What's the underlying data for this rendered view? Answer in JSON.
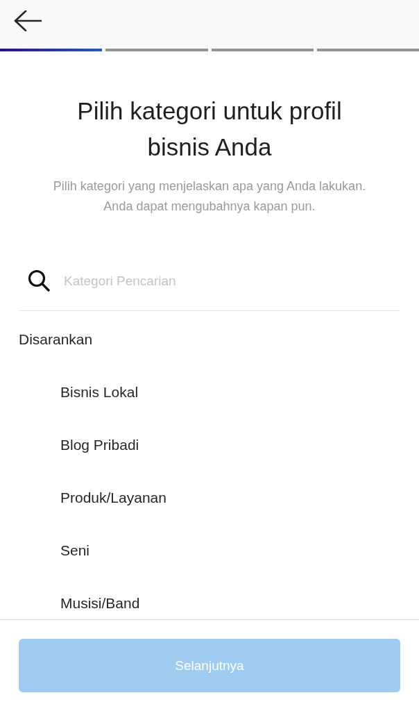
{
  "progress": {
    "steps": [
      {
        "completed": true
      },
      {
        "completed": false
      },
      {
        "completed": false
      },
      {
        "completed": false
      }
    ]
  },
  "title": "Pilih kategori untuk profil bisnis Anda",
  "subtitle": "Pilih kategori yang menjelaskan apa yang Anda lakukan. Anda dapat mengubahnya kapan pun.",
  "search": {
    "placeholder": "Kategori Pencarian"
  },
  "suggested": {
    "heading": "Disarankan",
    "items": [
      "Bisnis Lokal",
      "Blog Pribadi",
      "Produk/Layanan",
      "Seni",
      "Musisi/Band"
    ]
  },
  "next_button": {
    "label": "Selanjutnya",
    "disabled": true
  }
}
